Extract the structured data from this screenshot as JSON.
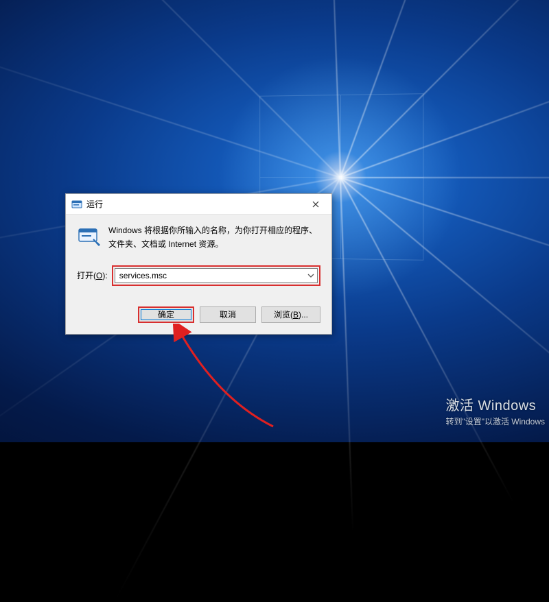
{
  "dialog": {
    "title": "运行",
    "description": "Windows 将根据你所输入的名称，为你打开相应的程序、文件夹、文档或 Internet 资源。",
    "open_label_prefix": "打开(",
    "open_label_hotkey": "O",
    "open_label_suffix": "):",
    "input_value": "services.msc",
    "buttons": {
      "ok": "确定",
      "cancel": "取消",
      "browse_prefix": "浏览(",
      "browse_hotkey": "B",
      "browse_suffix": ")..."
    }
  },
  "watermark": {
    "line1": "激活 Windows",
    "line2": "转到\"设置\"以激活 Windows"
  }
}
